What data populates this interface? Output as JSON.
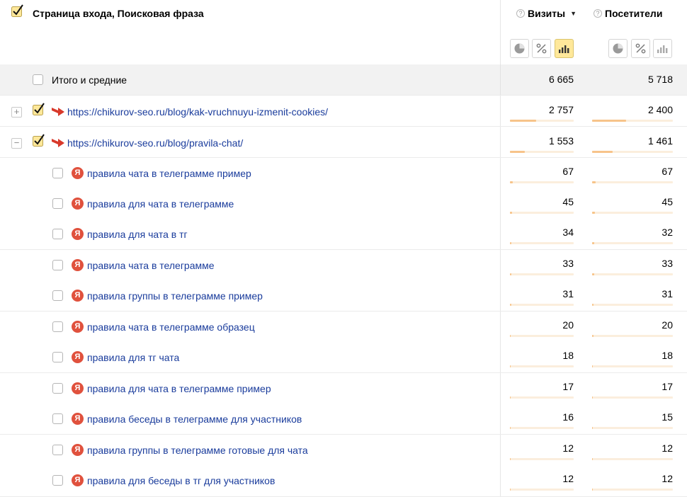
{
  "header": {
    "dimension_title": "Страница входа, Поисковая фраза",
    "metrics": [
      {
        "title": "Визиты",
        "sorted": true,
        "sort_arrow": "▼"
      },
      {
        "title": "Посетители",
        "sorted": false
      }
    ],
    "help_mark": "?"
  },
  "total": {
    "label": "Итого и средние",
    "visits": "6 665",
    "visitors": "5 718"
  },
  "pages": [
    {
      "url": "https://chikurov-seo.ru/blog/kak-vruchnuyu-izmenit-cookies/",
      "expander": "+",
      "visits": "2 757",
      "visitors": "2 400",
      "visits_share": 0.414,
      "visitors_share": 0.42
    },
    {
      "url": "https://chikurov-seo.ru/blog/pravila-chat/",
      "expander": "−",
      "visits": "1 553",
      "visitors": "1 461",
      "visits_share": 0.233,
      "visitors_share": 0.255
    }
  ],
  "phrases": [
    {
      "text": "правила чата в телеграмме пример",
      "visits": "67",
      "visitors": "67",
      "visits_share": 0.043,
      "visitors_share": 0.046
    },
    {
      "text": "правила для чата в телеграмме",
      "visits": "45",
      "visitors": "45",
      "visits_share": 0.029,
      "visitors_share": 0.031
    },
    {
      "text": "правила для чата в тг",
      "visits": "34",
      "visitors": "32",
      "visits_share": 0.022,
      "visitors_share": 0.022
    },
    {
      "text": "правила чата в телеграмме",
      "visits": "33",
      "visitors": "33",
      "visits_share": 0.021,
      "visitors_share": 0.023
    },
    {
      "text": "правила группы в телеграмме пример",
      "visits": "31",
      "visitors": "31",
      "visits_share": 0.02,
      "visitors_share": 0.021
    },
    {
      "text": "правила чата в телеграмме образец",
      "visits": "20",
      "visitors": "20",
      "visits_share": 0.013,
      "visitors_share": 0.014
    },
    {
      "text": "правила для тг чата",
      "visits": "18",
      "visitors": "18",
      "visits_share": 0.012,
      "visitors_share": 0.012
    },
    {
      "text": "правила для чата в телеграмме пример",
      "visits": "17",
      "visitors": "17",
      "visits_share": 0.011,
      "visitors_share": 0.012
    },
    {
      "text": "правила беседы в телеграмме для участников",
      "visits": "16",
      "visitors": "15",
      "visits_share": 0.01,
      "visitors_share": 0.01
    },
    {
      "text": "правила группы в телеграмме готовые для чата",
      "visits": "12",
      "visitors": "12",
      "visits_share": 0.008,
      "visitors_share": 0.008
    },
    {
      "text": "правила для беседы в тг для участников",
      "visits": "12",
      "visitors": "12",
      "visits_share": 0.008,
      "visitors_share": 0.008
    }
  ],
  "search_engine_icon": {
    "glyph": "Я",
    "color": "#e0513d"
  },
  "colors": {
    "link": "#1a3c9c",
    "bar_fill": "#f7c48a",
    "bar_track": "#fbeedd",
    "active_button": "#ffe89a",
    "check": "#ffe89a"
  }
}
